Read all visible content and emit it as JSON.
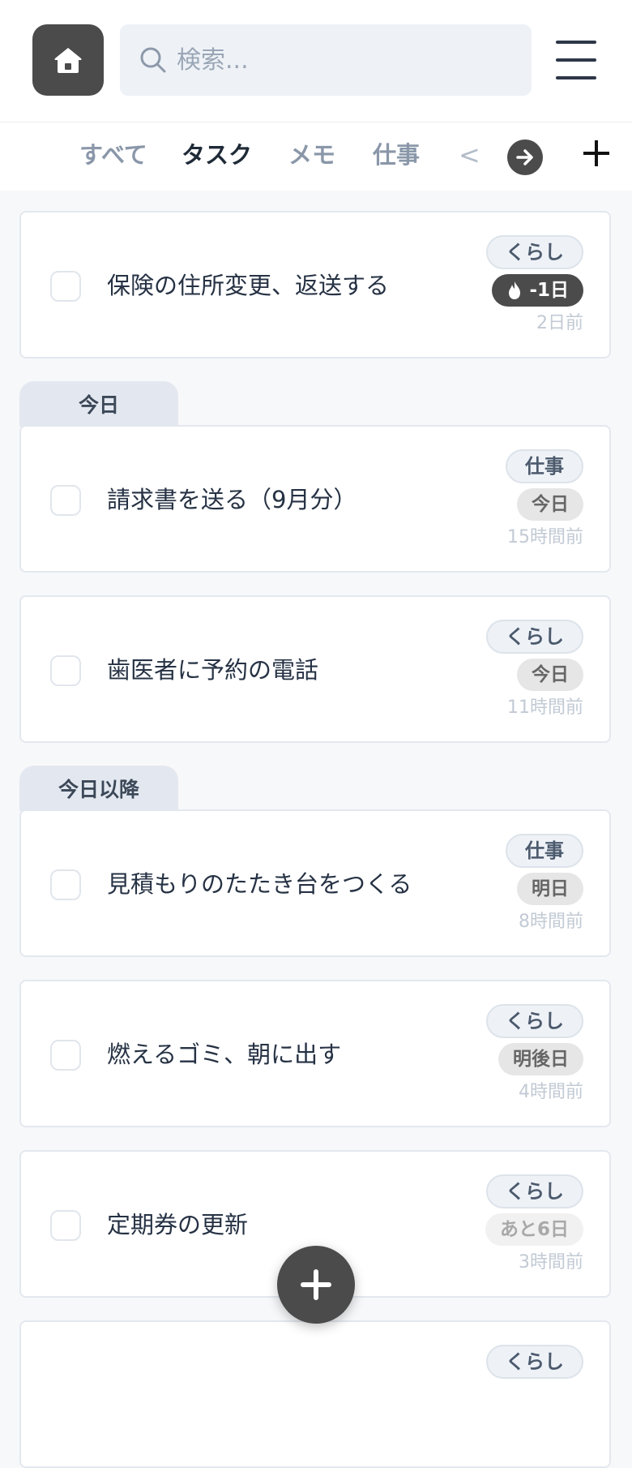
{
  "header": {
    "search_placeholder": "検索..."
  },
  "tabs": [
    {
      "label": "すべて",
      "active": false
    },
    {
      "label": "タスク",
      "active": true
    },
    {
      "label": "メモ",
      "active": false
    },
    {
      "label": "仕事",
      "active": false
    }
  ],
  "tab_prev": "<",
  "sections": [
    {
      "label": "今日"
    },
    {
      "label": "今日以降"
    }
  ],
  "tasks": [
    {
      "title": "保険の住所変更、返送する",
      "tag": "くらし",
      "due": "-1日",
      "ago": "2日前",
      "overdue": true
    },
    {
      "title": "請求書を送る（9月分）",
      "tag": "仕事",
      "due": "今日",
      "ago": "15時間前"
    },
    {
      "title": "歯医者に予約の電話",
      "tag": "くらし",
      "due": "今日",
      "ago": "11時間前"
    },
    {
      "title": "見積もりのたたき台をつくる",
      "tag": "仕事",
      "due": "明日",
      "ago": "8時間前"
    },
    {
      "title": "燃えるゴミ、朝に出す",
      "tag": "くらし",
      "due": "明後日",
      "ago": "4時間前"
    },
    {
      "title": "定期券の更新",
      "tag": "くらし",
      "due": "あと6日",
      "ago": "3時間前"
    },
    {
      "tag": "くらし"
    }
  ],
  "colors": {
    "dark": "#4b4b4b",
    "tag_bg": "#eef2f7",
    "section_bg": "#e3e8f0"
  },
  "icons": [
    "home-icon",
    "search-icon",
    "menu-icon",
    "arrow-right-icon",
    "plus-icon",
    "flame-icon",
    "fab-plus-icon"
  ]
}
